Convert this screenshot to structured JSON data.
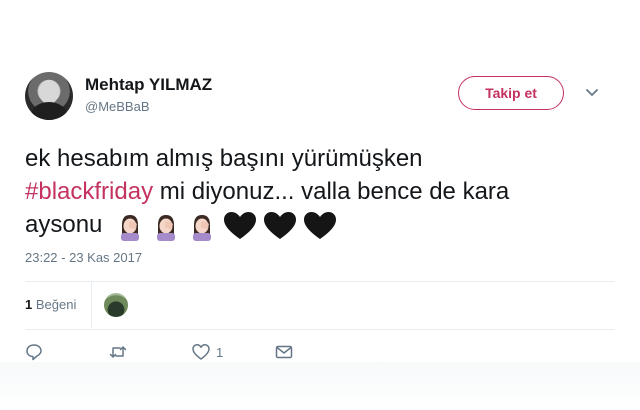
{
  "author": {
    "display_name": "Mehtap YILMAZ",
    "handle": "@MeBBaB"
  },
  "follow_button": {
    "label": "Takip et"
  },
  "tweet": {
    "line1": "ek hesabım almış başını yürümüşken",
    "hashtag": "#blackfriday",
    "line2_rest": " mi diyonuz... valla bence de kara",
    "line3": "aysonu",
    "emojis": [
      "facepalm-icon",
      "facepalm-icon",
      "facepalm-icon",
      "black-heart-icon",
      "black-heart-icon",
      "black-heart-icon"
    ]
  },
  "timestamp": "23:22 - 23 Kas 2017",
  "likes": {
    "count": "1",
    "label": "Beğeni"
  },
  "actions": {
    "reply_count": "",
    "retweet_count": "",
    "like_count": "1"
  },
  "colors": {
    "accent": "#c4325f",
    "muted": "#657786",
    "text": "#14171a",
    "divider": "#e6ecf0"
  }
}
